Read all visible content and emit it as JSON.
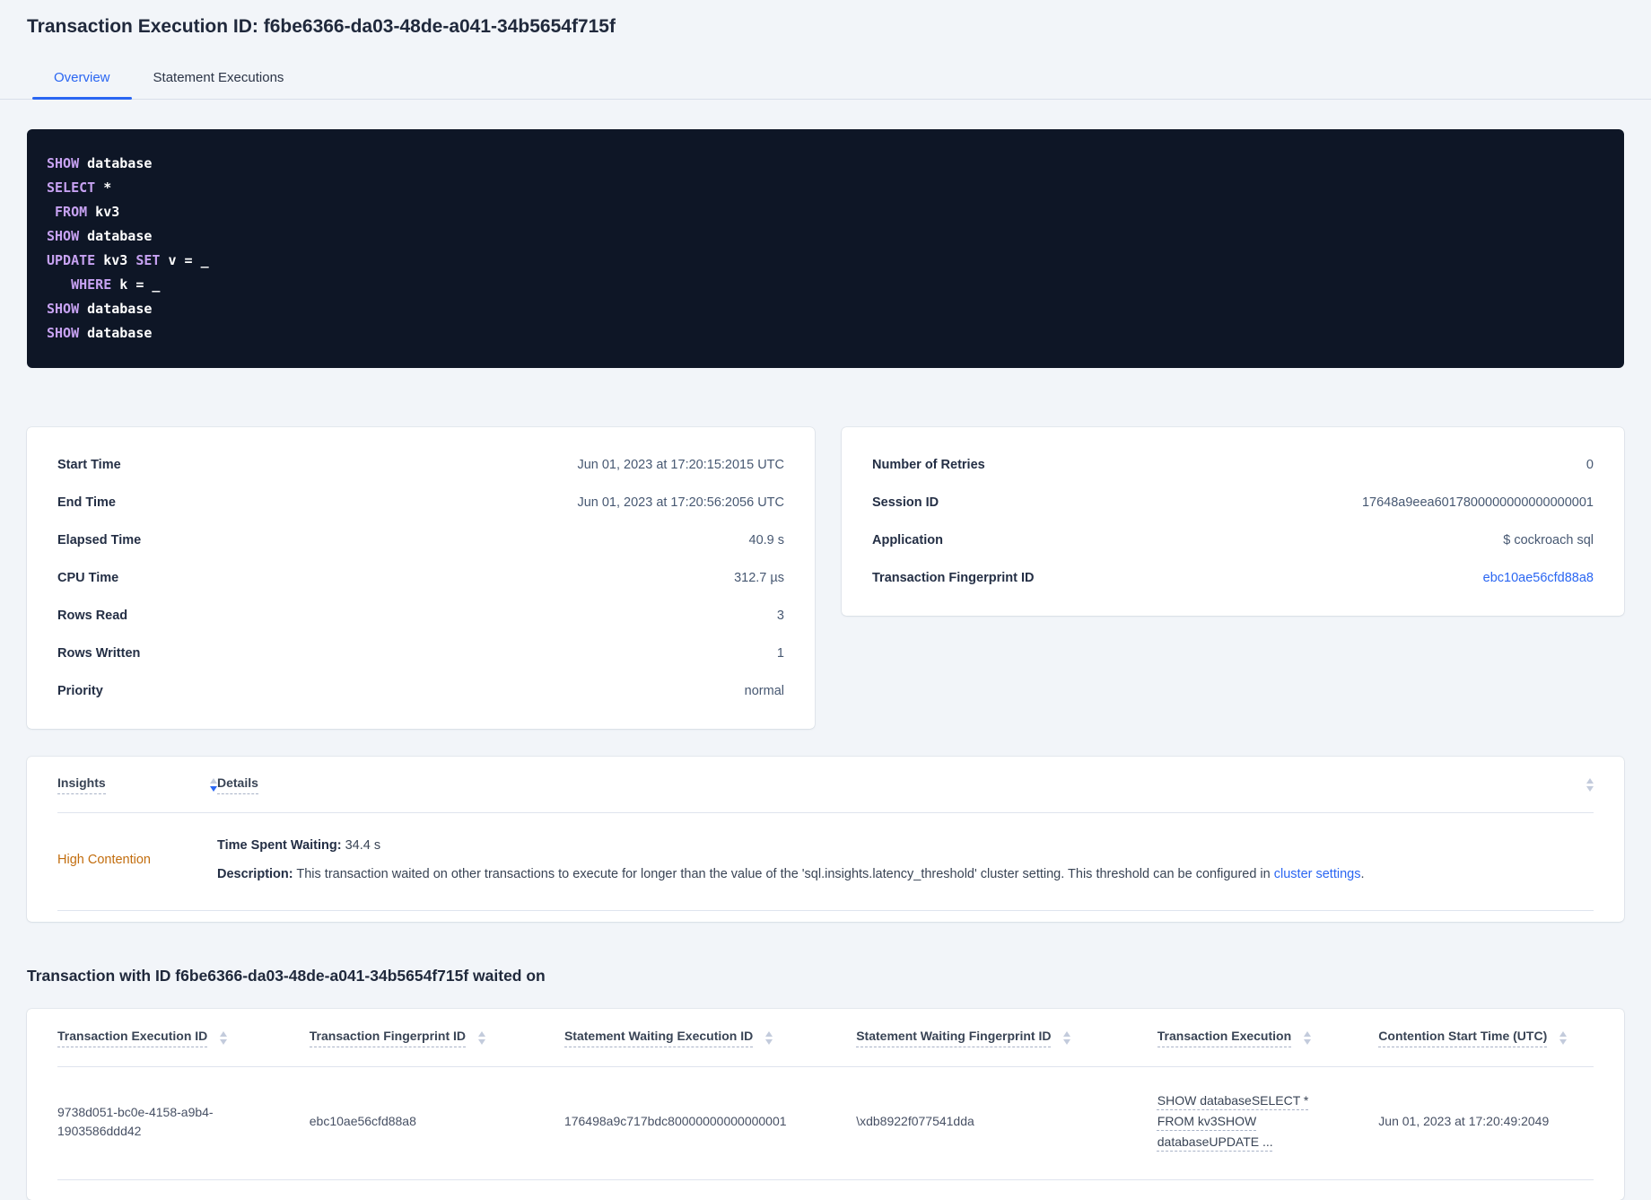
{
  "header": {
    "title": "Transaction Execution ID: f6be6366-da03-48de-a041-34b5654f715f",
    "tabs": [
      {
        "label": "Overview",
        "active": true
      },
      {
        "label": "Statement Executions",
        "active": false
      }
    ]
  },
  "sql": {
    "lines": [
      {
        "segments": [
          {
            "text": "SHOW",
            "kw": true
          },
          {
            "text": " database",
            "kw": false
          }
        ]
      },
      {
        "segments": [
          {
            "text": "SELECT",
            "kw": true
          },
          {
            "text": " *",
            "kw": false
          }
        ]
      },
      {
        "segments": [
          {
            "text": " ",
            "kw": false
          },
          {
            "text": "FROM",
            "kw": true
          },
          {
            "text": " kv3",
            "kw": false
          }
        ]
      },
      {
        "segments": [
          {
            "text": "SHOW",
            "kw": true
          },
          {
            "text": " database",
            "kw": false
          }
        ]
      },
      {
        "segments": [
          {
            "text": "UPDATE",
            "kw": true
          },
          {
            "text": " kv3 ",
            "kw": false
          },
          {
            "text": "SET",
            "kw": true
          },
          {
            "text": " v = _",
            "kw": false
          }
        ]
      },
      {
        "segments": [
          {
            "text": "   ",
            "kw": false
          },
          {
            "text": "WHERE",
            "kw": true
          },
          {
            "text": " k = _",
            "kw": false
          }
        ]
      },
      {
        "segments": [
          {
            "text": "SHOW",
            "kw": true
          },
          {
            "text": " database",
            "kw": false
          }
        ]
      },
      {
        "segments": [
          {
            "text": "SHOW",
            "kw": true
          },
          {
            "text": " database",
            "kw": false
          }
        ]
      }
    ]
  },
  "cards": {
    "left": {
      "rows": [
        {
          "label": "Start Time",
          "value": "Jun 01, 2023 at 17:20:15:2015 UTC"
        },
        {
          "label": "End Time",
          "value": "Jun 01, 2023 at 17:20:56:2056 UTC"
        },
        {
          "label": "Elapsed Time",
          "value": "40.9 s"
        },
        {
          "label": "CPU Time",
          "value": "312.7 µs"
        },
        {
          "label": "Rows Read",
          "value": "3"
        },
        {
          "label": "Rows Written",
          "value": "1"
        },
        {
          "label": "Priority",
          "value": "normal"
        }
      ]
    },
    "right": {
      "rows": [
        {
          "label": "Number of Retries",
          "value": "0"
        },
        {
          "label": "Session ID",
          "value": "17648a9eea6017800000000000000001"
        },
        {
          "label": "Application",
          "value": "$ cockroach sql"
        },
        {
          "label": "Transaction Fingerprint ID",
          "value": "ebc10ae56cfd88a8",
          "link": true
        }
      ]
    }
  },
  "insights_table": {
    "columns": [
      {
        "label": "Insights"
      },
      {
        "label": "Details"
      }
    ],
    "row": {
      "insight": "High Contention",
      "waiting_label": "Time Spent Waiting:",
      "waiting_value": "34.4 s",
      "description_label": "Description:",
      "description_text": "This transaction waited on other transactions to execute for longer than the value of the 'sql.insights.latency_threshold' cluster setting. This threshold can be configured in ",
      "description_link": "cluster settings",
      "description_suffix": "."
    }
  },
  "waited_on": {
    "heading": "Transaction with ID f6be6366-da03-48de-a041-34b5654f715f waited on",
    "columns": [
      "Transaction Execution ID",
      "Transaction Fingerprint ID",
      "Statement Waiting Execution ID",
      "Statement Waiting Fingerprint ID",
      "Transaction Execution",
      "Contention Start Time (UTC)"
    ],
    "row": {
      "transaction_execution_id": "9738d051-bc0e-4158-a9b4-1903586ddd42",
      "transaction_fingerprint_id": "ebc10ae56cfd88a8",
      "statement_waiting_execution_id": "176498a9c717bdc80000000000000001",
      "statement_waiting_fingerprint_id": "\\xdb8922f077541dda",
      "transaction_execution": "SHOW databaseSELECT * FROM kv3SHOW databaseUPDATE ...",
      "contention_start_time": "Jun 01, 2023 at 17:20:49:2049"
    }
  },
  "colors": {
    "accent_blue": "#2a66f2",
    "insight_orange": "#c26d0e",
    "sql_box_background": "#0e1626",
    "sql_keyword_purple": "#c7a2f2",
    "page_background": "#f2f5f9"
  }
}
